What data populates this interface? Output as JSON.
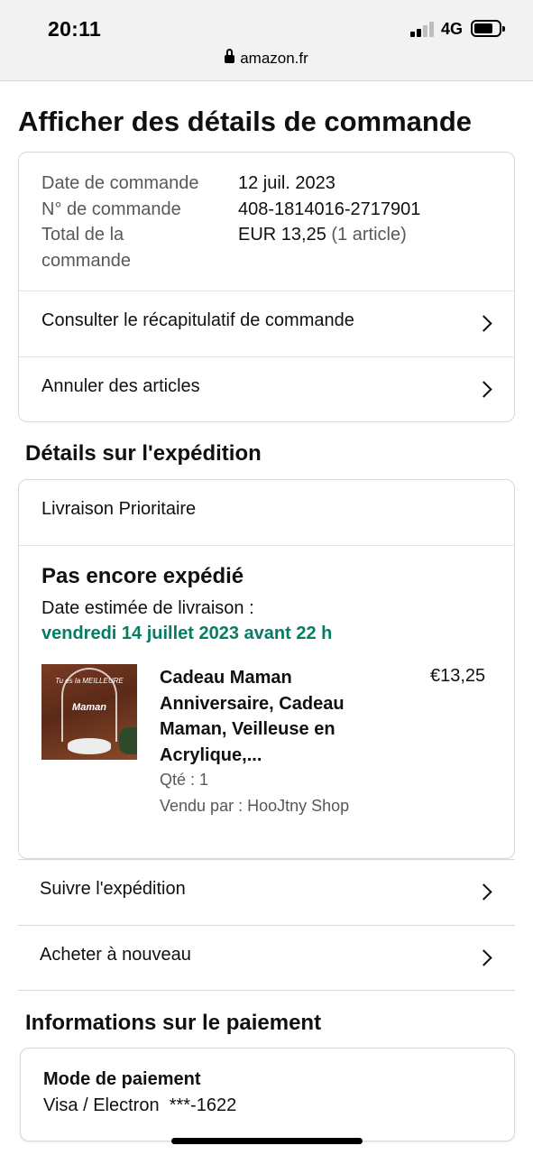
{
  "status_bar": {
    "time": "20:11",
    "network": "4G"
  },
  "browser": {
    "url": "amazon.fr"
  },
  "page": {
    "title": "Afficher des détails de commande"
  },
  "order_summary": {
    "date_label": "Date de commande",
    "date_value": "12 juil. 2023",
    "number_label": "N° de commande",
    "number_value": "408-1814016-2717901",
    "total_label_line1": "Total de la",
    "total_label_line2": "commande",
    "total_value": "EUR 13,25",
    "total_count": "(1 article)",
    "links": [
      {
        "label": "Consulter le récapitulatif de commande"
      },
      {
        "label": "Annuler des articles"
      }
    ]
  },
  "shipment": {
    "section_title": "Détails sur l'expédition",
    "method": "Livraison Prioritaire",
    "status": "Pas encore expédié",
    "estimate_label": "Date estimée de livraison :",
    "estimate_date": "vendredi 14 juillet 2023 avant 22 h",
    "item": {
      "title": "Cadeau Maman Anniversaire, Cadeau Maman, Veilleuse en Acrylique,...",
      "price": "€13,25",
      "quantity": "Qté : 1",
      "seller": "Vendu par : HooJtny Shop",
      "image_text_top": "Tu es la MEILLEURE",
      "image_text_main": "Maman"
    },
    "actions": [
      {
        "label": "Suivre l'expédition"
      },
      {
        "label": "Acheter à nouveau"
      }
    ]
  },
  "payment": {
    "section_title": "Informations sur le paiement",
    "method_label": "Mode de paiement",
    "method_value": "Visa / Electron  ***-1622"
  },
  "colors": {
    "delivery_green": "#067d62",
    "muted_text": "#565959",
    "border": "#d5d9d9"
  }
}
